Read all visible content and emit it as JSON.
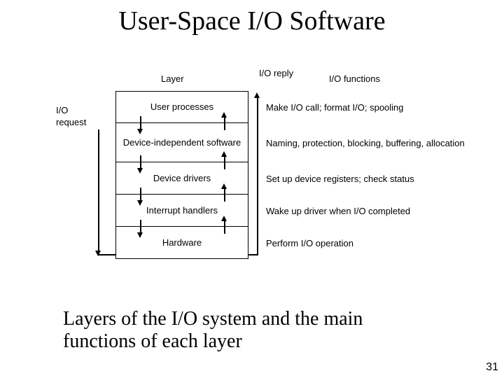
{
  "title": "User-Space I/O Software",
  "caption_line1": "Layers of the I/O system and the main",
  "caption_line2": "functions of each layer",
  "page_number": "31",
  "labels": {
    "io_request": "I/O request",
    "io_reply": "I/O reply",
    "io_functions": "I/O functions",
    "layer": "Layer"
  },
  "layers": [
    {
      "name": "User processes",
      "func": "Make I/O call; format I/O; spooling"
    },
    {
      "name": "Device-independent software",
      "func": "Naming, protection, blocking, buffering, allocation"
    },
    {
      "name": "Device drivers",
      "func": "Set up device registers; check status"
    },
    {
      "name": "Interrupt handlers",
      "func": "Wake up driver when I/O completed"
    },
    {
      "name": "Hardware",
      "func": "Perform I/O operation"
    }
  ]
}
